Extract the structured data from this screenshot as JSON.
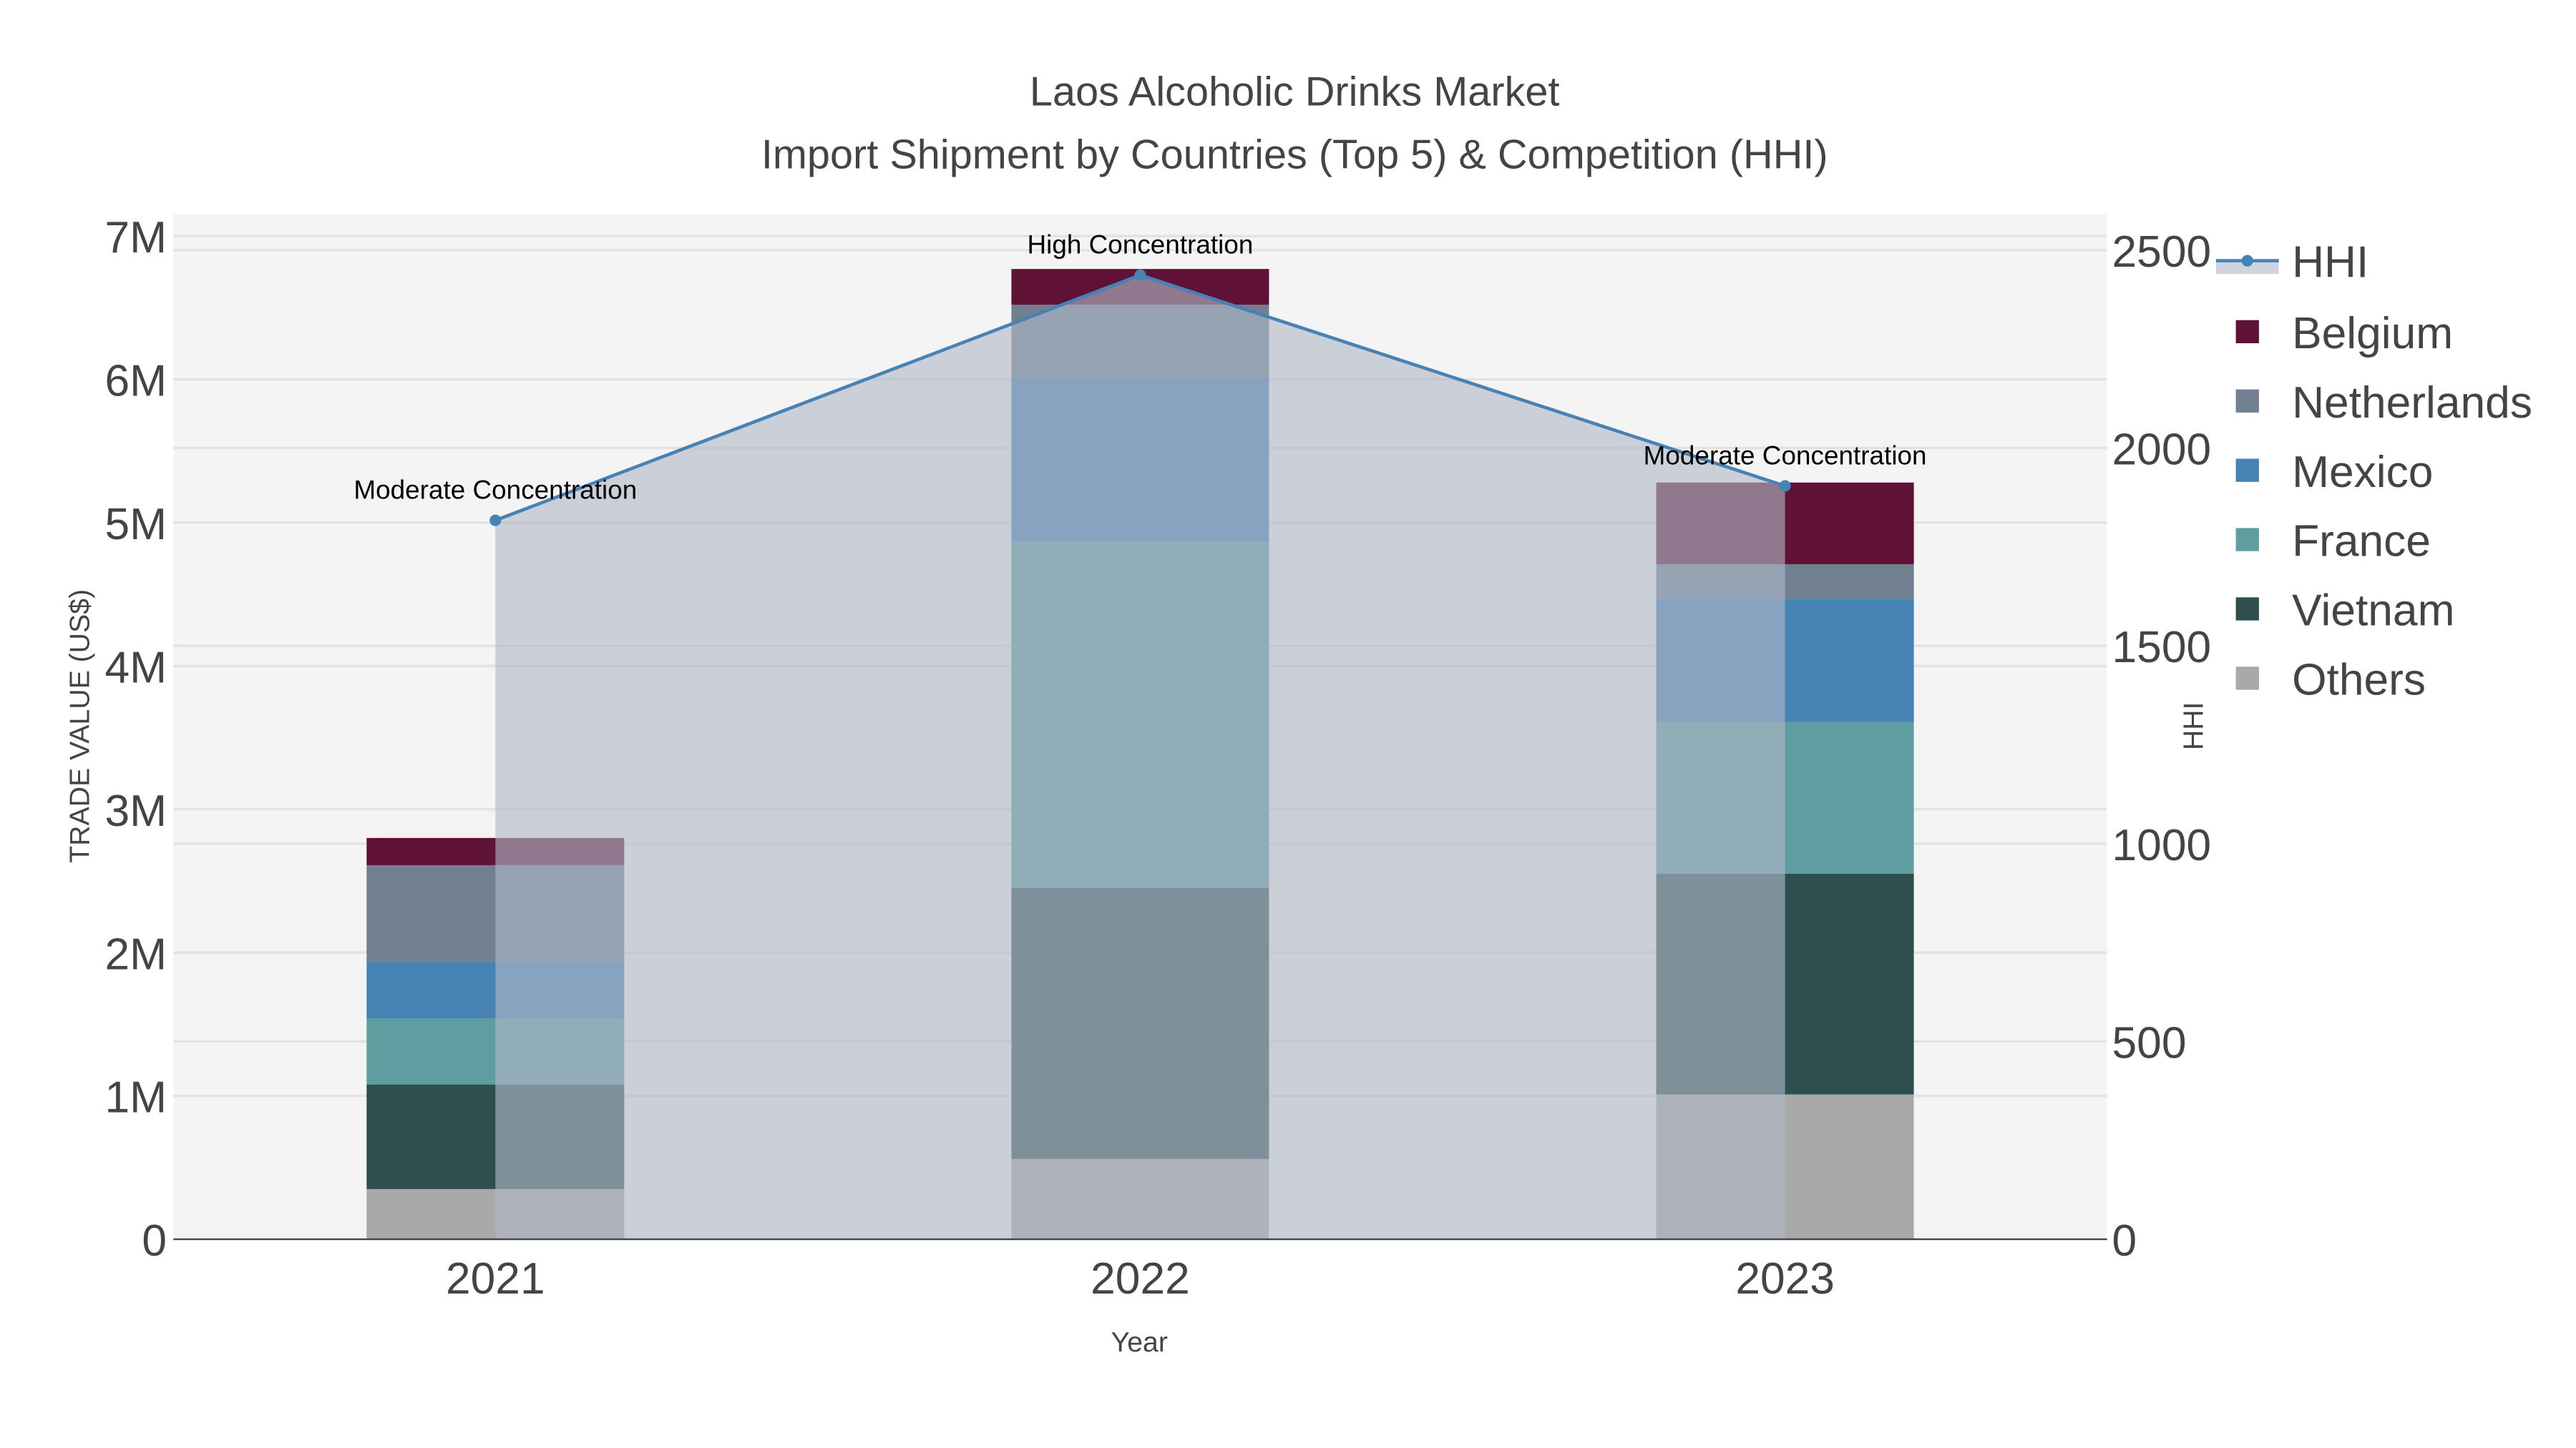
{
  "chart_data": {
    "type": "bar",
    "stacked": true,
    "title": "Laos Alcoholic Drinks Market",
    "subtitle": "Import Shipment by Countries (Top 5) & Competition (HHI)",
    "xlabel": "Year",
    "ylabel": "TRADE VALUE (US$)",
    "y2label": "HHI",
    "categories": [
      "2021",
      "2022",
      "2023"
    ],
    "ylim": [
      0,
      7150000
    ],
    "y2lim": [
      0,
      2590
    ],
    "yticks": [
      0,
      1000000,
      2000000,
      3000000,
      4000000,
      5000000,
      6000000,
      7000000
    ],
    "ytick_labels": [
      "0",
      "1M",
      "2M",
      "3M",
      "4M",
      "5M",
      "6M",
      "7M"
    ],
    "y2ticks": [
      0,
      500,
      1000,
      1500,
      2000,
      2500
    ],
    "y2tick_labels": [
      "0",
      "500",
      "1000",
      "1500",
      "2000",
      "2500"
    ],
    "grid": true,
    "legend_position": "right",
    "series": [
      {
        "name": "Others",
        "color": "#a9a9a9",
        "values": [
          350000,
          560000,
          1010000
        ]
      },
      {
        "name": "Vietnam",
        "color": "#2f4f4f",
        "values": [
          730000,
          1890000,
          1540000
        ]
      },
      {
        "name": "France",
        "color": "#5f9ea0",
        "values": [
          460000,
          2420000,
          1060000
        ]
      },
      {
        "name": "Mexico",
        "color": "#4682b4",
        "values": [
          400000,
          1140000,
          860000
        ]
      },
      {
        "name": "Netherlands",
        "color": "#708090",
        "values": [
          670000,
          510000,
          240000
        ]
      },
      {
        "name": "Belgium",
        "color": "#5f1236",
        "values": [
          190000,
          250000,
          570000
        ]
      }
    ],
    "hhi": {
      "name": "HHI",
      "type": "line",
      "axis": "right",
      "color": "#4682b4",
      "values": [
        1817,
        2437,
        1904
      ],
      "annotations": [
        "Moderate Concentration",
        "High Concentration",
        "Moderate Concentration"
      ]
    },
    "legend_order": [
      "HHI",
      "Belgium",
      "Netherlands",
      "Mexico",
      "France",
      "Vietnam",
      "Others"
    ]
  }
}
